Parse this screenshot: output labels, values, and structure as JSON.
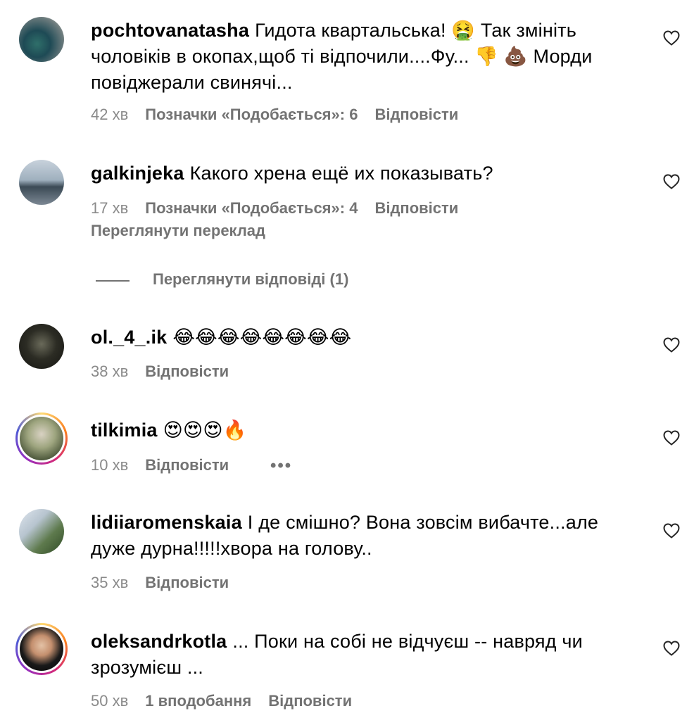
{
  "comments": [
    {
      "username": "pochtovanatasha",
      "text": "Гидота квартальська! 🤮 Так змініть чоловіків в окопах,щоб ті відпочили....Фу... 👎 💩 Морди повіджерали свинячі...",
      "time": "42 хв",
      "likes": "Позначки «Подобається»: 6",
      "reply": "Відповісти"
    },
    {
      "username": "galkinjeka",
      "text": "Какого хрена ещё их показывать?",
      "time": "17 хв",
      "likes": "Позначки «Подобається»: 4",
      "reply": "Відповісти",
      "translate": "Переглянути переклад",
      "view_replies": "Переглянути відповіді (1)"
    },
    {
      "username": "ol._4_.ik",
      "text": "😂😂😂😂😂😂😂😂",
      "time": "38 хв",
      "reply": "Відповісти"
    },
    {
      "username": "tilkimia",
      "text": "😍😍😍🔥",
      "time": "10 хв",
      "reply": "Відповісти",
      "more": "•••"
    },
    {
      "username": "lidiiaromenskaia",
      "text": "І де смішно? Вона зовсім вибачте...але дуже дурна!!!!!хвора на голову..",
      "time": "35 хв",
      "reply": "Відповісти"
    },
    {
      "username": "oleksandrkotla",
      "text": "... Поки на собі не відчуєш -- навряд чи зрозумієш ...",
      "time": "50 хв",
      "likes": "1 вподобання",
      "reply": "Відповісти"
    }
  ],
  "colors": {
    "secondary_text": "#737373",
    "story_ring": "#d62976"
  },
  "icons": {
    "like": "heart-outline-icon"
  }
}
